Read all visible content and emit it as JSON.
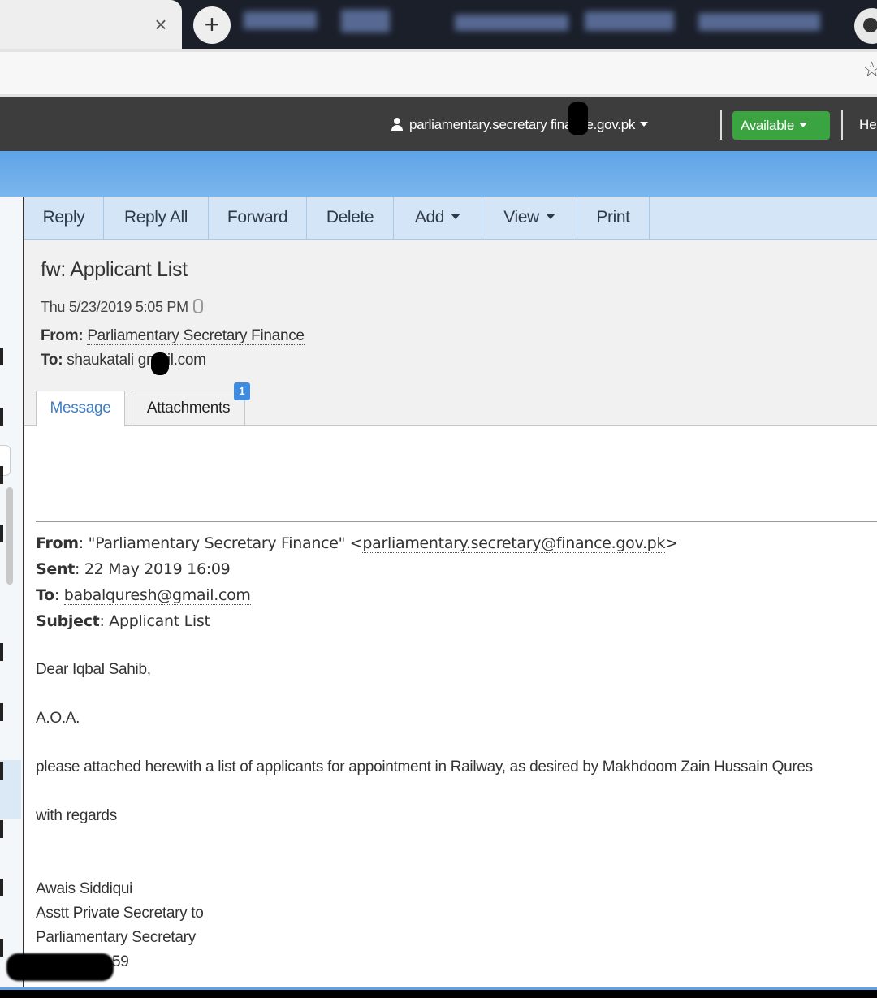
{
  "browser": {
    "newtab_symbol": "+",
    "close_symbol": "×",
    "bookmark_symbol": "☆",
    "icons": [
      "close-icon",
      "plus-icon",
      "star-icon",
      "profile-icon"
    ]
  },
  "header": {
    "user_account": "parliamentary.secretary  finance.gov.pk",
    "status": "Available",
    "help": "He",
    "status_color": "#3aa540",
    "bar_color": "#3d3d3d"
  },
  "toolbar": {
    "reply": "Reply",
    "reply_all": "Reply All",
    "forward": "Forward",
    "delete": "Delete",
    "add": "Add",
    "view": "View",
    "print": "Print",
    "color": "#d3e5f7"
  },
  "message": {
    "subject": "fw: Applicant List",
    "date": "Thu 5/23/2019 5:05 PM",
    "from_label": "From:",
    "from": "Parliamentary Secretary Finance",
    "to_label": "To:",
    "to": "shaukatali   gmail.com",
    "tabs": {
      "message": "Message",
      "attachments": "Attachments",
      "attachment_count": "1"
    }
  },
  "forwarded": {
    "from_label": "From",
    "from_name": ": \"Parliamentary Secretary Finance\" <",
    "from_email": "parliamentary.secretary@finance.gov.pk",
    "from_end": ">",
    "sent_label": "Sent",
    "sent": ": 22 May 2019 16:09",
    "to_label": "To",
    "to_sep": ": ",
    "to": "babalquresh@gmail.com",
    "subject_label": "Subject",
    "subject": ": Applicant List"
  },
  "body": {
    "greeting": "Dear Iqbal Sahib,",
    "salutation": "A.O.A.",
    "text": "please attached herewith a list of applicants for appointment in Railway, as desired by Makhdoom Zain Hussain Qures",
    "closing": "with regards",
    "signature_name": "Awais Siddiqui",
    "signature_title1": "Asstt Private Secretary to",
    "signature_title2": "Parliamentary Secretary",
    "signature_phone_tail": "59"
  }
}
